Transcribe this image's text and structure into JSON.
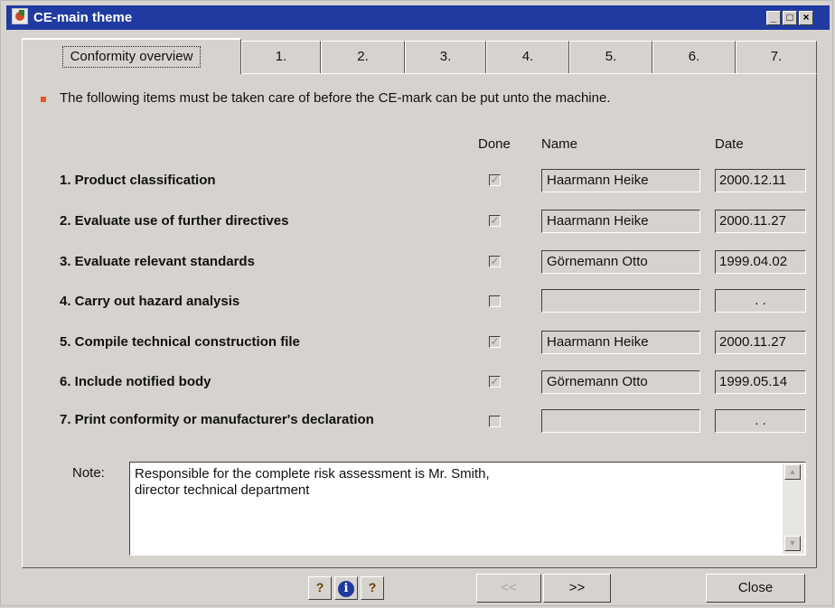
{
  "window": {
    "title": "CE-main theme",
    "controls": {
      "minimize": "_",
      "maximize": "□",
      "close": "×"
    }
  },
  "tabs": [
    {
      "label": "Conformity overview",
      "active": true
    },
    {
      "label": "1."
    },
    {
      "label": "2."
    },
    {
      "label": "3."
    },
    {
      "label": "4."
    },
    {
      "label": "5."
    },
    {
      "label": "6."
    },
    {
      "label": "7."
    }
  ],
  "intro": "The following items must be taken care of before the CE-mark can be put unto the machine.",
  "columns": {
    "done": "Done",
    "name": "Name",
    "date": "Date"
  },
  "rows": [
    {
      "label": "1. Product classification",
      "done": true,
      "name": "Haarmann Heike",
      "date": "2000.12.11"
    },
    {
      "label": "2. Evaluate use of further directives",
      "done": true,
      "name": "Haarmann Heike",
      "date": "2000.11.27"
    },
    {
      "label": "3. Evaluate relevant standards",
      "done": true,
      "name": "Görnemann Otto",
      "date": "1999.04.02"
    },
    {
      "label": "4. Carry out hazard analysis",
      "done": false,
      "name": "",
      "date": ". ."
    },
    {
      "label": "5. Compile technical construction file",
      "done": true,
      "name": "Haarmann Heike",
      "date": "2000.11.27"
    },
    {
      "label": "6. Include notified body",
      "done": true,
      "name": "Görnemann Otto",
      "date": "1999.05.14"
    },
    {
      "label": "7. Print conformity or manufacturer's declaration",
      "done": false,
      "name": "",
      "date": ". ."
    }
  ],
  "note": {
    "label": "Note:",
    "lines": [
      "Responsible for the complete risk assessment is Mr. Smith,",
      "director technical department"
    ]
  },
  "toolbar": {
    "help_icon_text": "?",
    "info_icon_text": "i",
    "prev_label": "<<",
    "next_label": ">>",
    "close_label": "Close"
  },
  "colors": {
    "titlebar": "#1f3aa0",
    "bullet": "#e8552a",
    "face": "#d6d3ce"
  }
}
